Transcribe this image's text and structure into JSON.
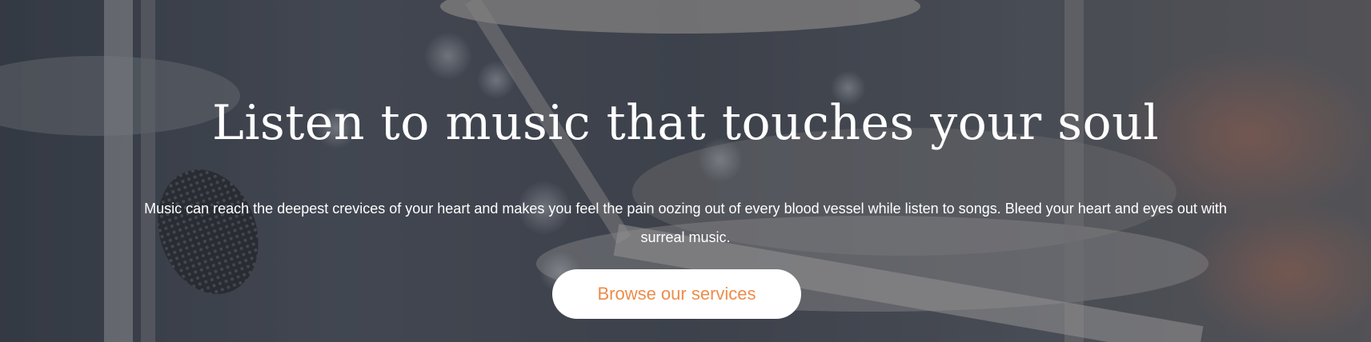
{
  "hero": {
    "title": "Listen to music that touches your soul",
    "subtitle": "Music can reach the deepest crevices of your heart and makes you feel the pain oozing out of every blood vessel while listen to songs. Bleed your heart and eyes out with surreal music.",
    "cta_label": "Browse our services"
  },
  "colors": {
    "cta_text": "#ed8c4a",
    "cta_background": "#ffffff",
    "text": "#ffffff",
    "backdrop": "#4a4e57"
  }
}
